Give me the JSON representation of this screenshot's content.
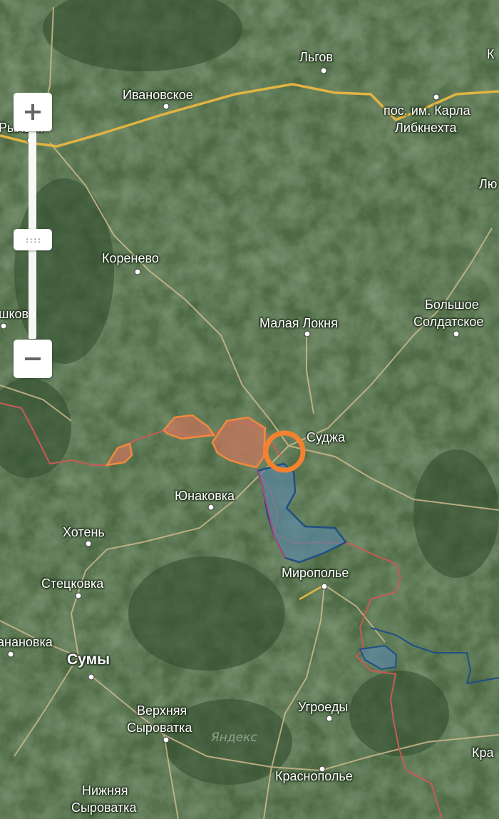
{
  "map": {
    "watermark": "Яндекс",
    "colors": {
      "terrain": "#4e6b45",
      "road_primary": "#e2b441",
      "road_secondary": "#cdb98c",
      "border": "#c95a55",
      "zone_orange_fill": "#c7775c",
      "zone_orange_stroke": "#f08a3e",
      "zone_blue_fill": "#5b87a3",
      "zone_blue_stroke": "#1f4f86",
      "marker": "#f4812f"
    },
    "places": [
      {
        "id": "lgov",
        "name": "Льгов"
      },
      {
        "id": "k-top-right",
        "name": "К"
      },
      {
        "id": "ivanovskoe",
        "name": "Ивановское"
      },
      {
        "id": "rylsk",
        "name": "Рыльск"
      },
      {
        "id": "karl-liebknecht-1",
        "name": "пос. им. Карла"
      },
      {
        "id": "karl-liebknecht-2",
        "name": "Либкнехта"
      },
      {
        "id": "lyu-right",
        "name": "Лю"
      },
      {
        "id": "korenevo",
        "name": "Коренево"
      },
      {
        "id": "shkovo",
        "name": "шково"
      },
      {
        "id": "malaya-loknya",
        "name": "Малая Локня"
      },
      {
        "id": "bolshoe-1",
        "name": "Большое"
      },
      {
        "id": "bolshoe-2",
        "name": "Солдатское"
      },
      {
        "id": "sudzha",
        "name": "Суджа"
      },
      {
        "id": "yunakovka",
        "name": "Юнаковка"
      },
      {
        "id": "khoten",
        "name": "Хотень"
      },
      {
        "id": "miropolye",
        "name": "Миропольe"
      },
      {
        "id": "stetskovka",
        "name": "Стецковка"
      },
      {
        "id": "ananovka",
        "name": "анaновка"
      },
      {
        "id": "sumy",
        "name": "Сумы"
      },
      {
        "id": "ugroedy",
        "name": "Угроеды"
      },
      {
        "id": "verkhnyaya-1",
        "name": "Верхняя"
      },
      {
        "id": "verkhnyaya-2",
        "name": "Сыроватка"
      },
      {
        "id": "kra-right",
        "name": "Кра"
      },
      {
        "id": "krasnopolye",
        "name": "Краснополье"
      },
      {
        "id": "nizhnyaya-1",
        "name": "Нижняя"
      },
      {
        "id": "nizhnyaya-2",
        "name": "Сыроватка"
      }
    ],
    "zoom_controls": {
      "zoom_in_icon": "plus-icon",
      "zoom_out_icon": "minus-icon",
      "handle_icon": "grip-dots-icon",
      "handle_label": "::::"
    }
  }
}
